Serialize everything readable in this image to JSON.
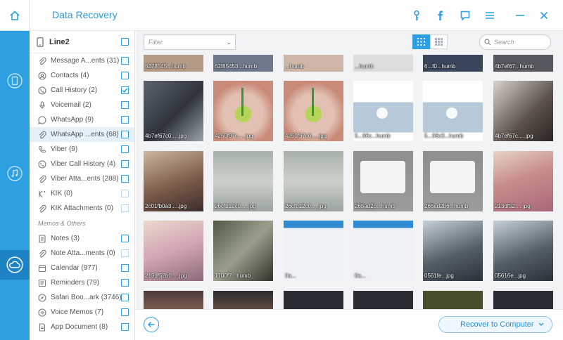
{
  "app": {
    "title": "Data Recovery",
    "window_controls": [
      "key-icon",
      "facebook-icon",
      "feedback-icon",
      "menu-icon",
      "minimize-icon",
      "close-icon"
    ]
  },
  "rail": {
    "items": [
      {
        "icon": "device-restore-icon",
        "active": false
      },
      {
        "icon": "music-restore-icon",
        "active": false
      },
      {
        "icon": "cloud-restore-icon",
        "active": true
      }
    ]
  },
  "panel": {
    "device_label": "Line2",
    "categories": [
      {
        "label": "Message A...ents (31)",
        "icon": "paperclip-icon",
        "checked": false,
        "selected": false
      },
      {
        "label": "Contacts (4)",
        "icon": "contacts-icon",
        "checked": false,
        "selected": false
      },
      {
        "label": "Call History (2)",
        "icon": "phone-icon",
        "checked": true,
        "selected": false
      },
      {
        "label": "Voicemail (2)",
        "icon": "microphone-icon",
        "checked": false,
        "selected": false
      },
      {
        "label": "WhatsApp (9)",
        "icon": "whatsapp-icon",
        "checked": false,
        "selected": false
      },
      {
        "label": "WhatsApp ...ents (68)",
        "icon": "paperclip-icon",
        "checked": false,
        "selected": true
      },
      {
        "label": "Viber (9)",
        "icon": "viber-icon",
        "checked": false,
        "selected": false
      },
      {
        "label": "Viber Call History (4)",
        "icon": "phone-icon",
        "checked": false,
        "selected": false
      },
      {
        "label": "Viber Atta...ents (288)",
        "icon": "paperclip-icon",
        "checked": false,
        "selected": false
      },
      {
        "label": "KIK (0)",
        "icon": "kik-icon",
        "checked": false,
        "selected": false,
        "disabled": true
      },
      {
        "label": "KIK Attachments (0)",
        "icon": "paperclip-icon",
        "checked": false,
        "selected": false,
        "disabled": true
      }
    ],
    "section_title": "Memos & Others",
    "memo_categories": [
      {
        "label": "Notes (3)",
        "icon": "notes-icon",
        "checked": false
      },
      {
        "label": "Note Atta...ments (0)",
        "icon": "paperclip-icon",
        "checked": false,
        "disabled": true
      },
      {
        "label": "Calendar (977)",
        "icon": "calendar-icon",
        "checked": false
      },
      {
        "label": "Reminders (79)",
        "icon": "reminders-icon",
        "checked": false
      },
      {
        "label": "Safari Boo...ark (3746)",
        "icon": "safari-icon",
        "checked": false
      },
      {
        "label": "Voice Memos (7)",
        "icon": "voice-memo-icon",
        "checked": false
      },
      {
        "label": "App Document (8)",
        "icon": "document-icon",
        "checked": false
      }
    ]
  },
  "toolbar": {
    "filter_placeholder": "Filter",
    "search_placeholder": "Search"
  },
  "thumbnails": {
    "row0": [
      "6278545...humb",
      "62f85453...humb",
      "...humb",
      "...humb",
      "6...f0...humb",
      "4b7ef67...humb"
    ],
    "row1": [
      "4b7ef67c0.....jpg",
      "4250f97c.....jpg",
      "4250f97c0.....jpg",
      "5...96c...humb",
      "5...96c3...humb",
      "4b7ef67c.....jpg"
    ],
    "row2": [
      "2c01fb0a3.....jpg",
      "26cfb12c0.....jpg",
      "26cfb12c0.....jpg",
      "265ad2b...humb",
      "265ad2b6...humb",
      "213df52.....jpg"
    ],
    "row3": [
      "213df52b0.....jpg",
      "1700f7...humb",
      "0a...",
      "0a...",
      "0561fe...jpg",
      "05616e...jpg"
    ],
    "row4": [
      "",
      "",
      "",
      "",
      "",
      ""
    ]
  },
  "bottom": {
    "recover_label": "Recover to Computer"
  }
}
